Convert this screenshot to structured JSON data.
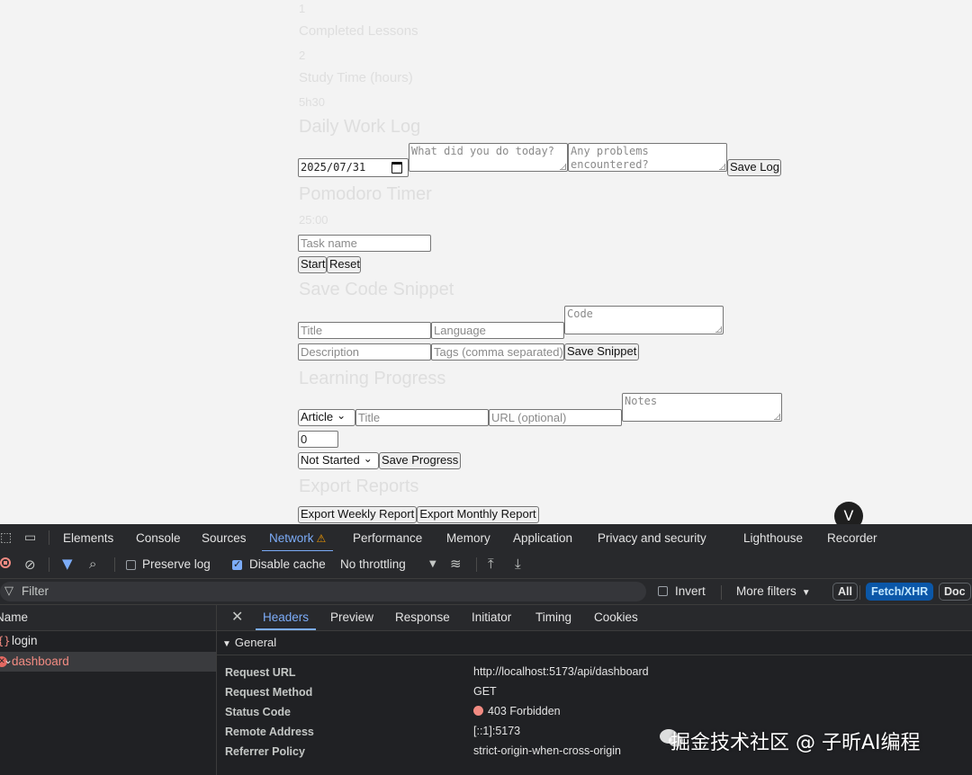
{
  "page": {
    "faded": {
      "number_top": "1",
      "completed_lessons": "Completed Lessons",
      "number_mid": "2",
      "study_time": "Study Time (hours)",
      "value_small": "5h30",
      "daily_work_log": "Daily Work Log",
      "pomodoro_timer": "Pomodoro Timer",
      "timer_value": "25:00",
      "save_code_snippet": "Save Code Snippet",
      "learning_progress": "Learning Progress",
      "export_reports": "Export Reports"
    },
    "worklog": {
      "date_value": "2025/07/31",
      "done_placeholder": "What did you do today?",
      "problems_placeholder": "Any problems encountered?",
      "save_label": "Save Log"
    },
    "pomodoro": {
      "task_placeholder": "Task name",
      "start_label": "Start",
      "reset_label": "Reset"
    },
    "snippet": {
      "title_placeholder": "Title",
      "language_placeholder": "Language",
      "code_placeholder": "Code",
      "description_placeholder": "Description",
      "tags_placeholder": "Tags (comma separated)",
      "save_label": "Save Snippet"
    },
    "progress": {
      "type_value": "Article",
      "title_placeholder": "Title",
      "url_placeholder": "URL (optional)",
      "notes_placeholder": "Notes",
      "percent_value": "0",
      "status_value": "Not Started",
      "save_label": "Save Progress"
    },
    "export": {
      "weekly_label": "Export Weekly Report",
      "monthly_label": "Export Monthly Report"
    },
    "scroll_chevron": "V"
  },
  "devtools": {
    "tabs": [
      "Elements",
      "Console",
      "Sources",
      "Network",
      "Performance",
      "Memory",
      "Application",
      "Privacy and security",
      "Lighthouse",
      "Recorder"
    ],
    "active_tab": "Network",
    "network_warning": "⚠",
    "toolbar": {
      "preserve_log": "Preserve log",
      "disable_cache": "Disable cache",
      "throttling": "No throttling"
    },
    "filter": {
      "placeholder": "Filter",
      "invert": "Invert",
      "more_filters": "More filters",
      "all": "All",
      "fetch_xhr": "Fetch/XHR",
      "doc": "Doc"
    },
    "requests": {
      "header": "Name",
      "items": [
        {
          "name": "login",
          "status": "ok"
        },
        {
          "name": "dashboard",
          "status": "error"
        }
      ]
    },
    "detail_tabs": [
      "Headers",
      "Preview",
      "Response",
      "Initiator",
      "Timing",
      "Cookies"
    ],
    "active_detail_tab": "Headers",
    "general": {
      "title": "General",
      "rows": [
        {
          "key": "Request URL",
          "value": "http://localhost:5173/api/dashboard"
        },
        {
          "key": "Request Method",
          "value": "GET"
        },
        {
          "key": "Status Code",
          "value": "403 Forbidden"
        },
        {
          "key": "Remote Address",
          "value": "[::1]:5173"
        },
        {
          "key": "Referrer Policy",
          "value": "strict-origin-when-cross-origin"
        }
      ]
    },
    "colors": {
      "accent": "#7cacf8",
      "error": "#f28b82",
      "panel": "#202124"
    }
  },
  "watermark": "掘金技术社区 @ 子昕AI编程"
}
